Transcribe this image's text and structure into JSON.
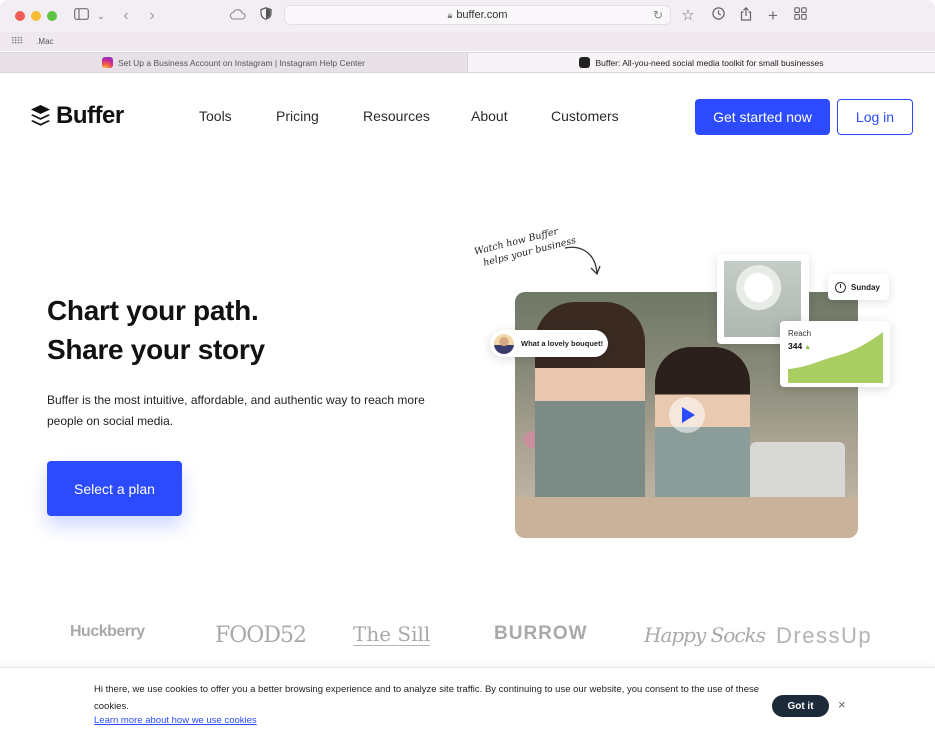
{
  "browser": {
    "url": "buffer.com",
    "bookmark": ".Mac",
    "tabs": [
      {
        "label": "Set Up a Business Account on Instagram | Instagram Help Center",
        "active": false
      },
      {
        "label": "Buffer: All-you-need social media toolkit for small businesses",
        "active": true
      }
    ]
  },
  "header": {
    "logo": "Buffer",
    "nav": [
      "Tools",
      "Pricing",
      "Resources",
      "About",
      "Customers"
    ],
    "cta_primary": "Get started now",
    "cta_secondary": "Log in"
  },
  "hero": {
    "title_line1": "Chart your path.",
    "title_line2": "Share your story",
    "description": "Buffer is the most intuitive, affordable, and authentic way to reach more people on social media.",
    "cta": "Select a plan",
    "handwriting_line1": "Watch how Buffer",
    "handwriting_line2": "helps your business",
    "comment": "What a lovely bouquet!",
    "day": "Sunday",
    "reach_label": "Reach",
    "reach_value": "344"
  },
  "brands": [
    "Huckberry",
    "FOOD52",
    "The Sill",
    "BURROW",
    "Happy Socks",
    "DressUp"
  ],
  "cookie": {
    "message": "Hi there, we use cookies to offer you a better browsing experience and to analyze site traffic. By continuing to use our website, you consent to the use of these cookies.",
    "link": "Learn more about how we use cookies",
    "button": "Got it",
    "close": "×"
  },
  "colors": {
    "accent": "#2c4bff",
    "chart_fill": "#a9cf63",
    "cookie_button": "#1d2a3a"
  }
}
